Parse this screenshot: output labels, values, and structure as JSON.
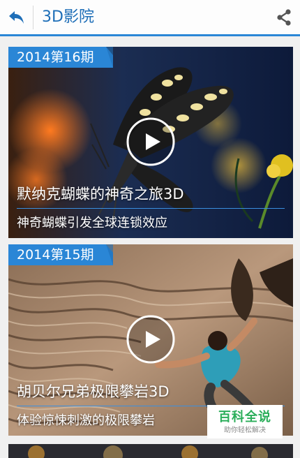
{
  "header": {
    "title": "3D影院",
    "back_icon": "back-arrow-icon",
    "share_icon": "share-icon",
    "accent": "#2a86d6"
  },
  "cards": [
    {
      "issue": "2014第16期",
      "title": "默纳克蝴蝶的神奇之旅3D",
      "subtitle": "神奇蝴蝶引发全球连锁效应",
      "play_icon": "play-icon"
    },
    {
      "issue": "2014第15期",
      "title": "胡贝尔兄弟极限攀岩3D",
      "subtitle": "体验惊悚刺激的极限攀岩",
      "play_icon": "play-icon"
    }
  ],
  "watermark": {
    "main": "百科全说",
    "sub": "助你轻松解决"
  }
}
